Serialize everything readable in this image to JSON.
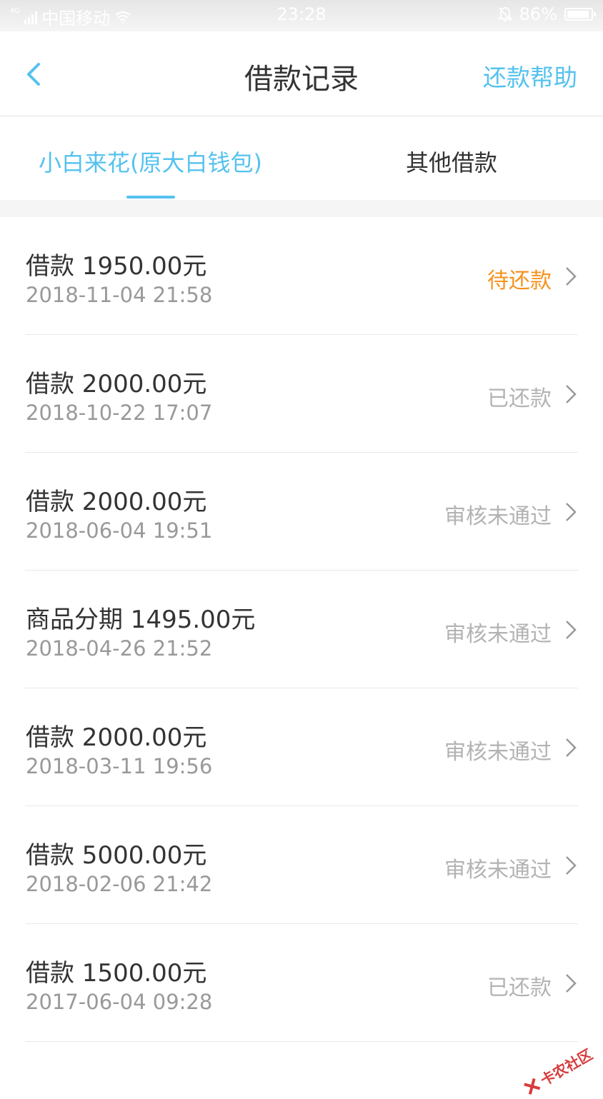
{
  "status_bar": {
    "network_type": "4G",
    "carrier": "中国移动",
    "time": "23:28",
    "battery": "86%",
    "icons": [
      "signal-icon",
      "wifi-icon",
      "bell-off-icon",
      "battery-icon"
    ]
  },
  "header": {
    "title": "借款记录",
    "help_label": "还款帮助",
    "back_icon": "chevron-left-icon"
  },
  "tabs": [
    {
      "label": "小白来花(原大白钱包)",
      "active": true
    },
    {
      "label": "其他借款",
      "active": false
    }
  ],
  "records": [
    {
      "title": "借款 1950.00元",
      "date": "2018-11-04 21:58",
      "status": "待还款",
      "status_type": "pending"
    },
    {
      "title": "借款 2000.00元",
      "date": "2018-10-22 17:07",
      "status": "已还款",
      "status_type": "repaid"
    },
    {
      "title": "借款 2000.00元",
      "date": "2018-06-04 19:51",
      "status": "审核未通过",
      "status_type": "rejected"
    },
    {
      "title": "商品分期 1495.00元",
      "date": "2018-04-26 21:52",
      "status": "审核未通过",
      "status_type": "rejected"
    },
    {
      "title": "借款 2000.00元",
      "date": "2018-03-11 19:56",
      "status": "审核未通过",
      "status_type": "rejected"
    },
    {
      "title": "借款 5000.00元",
      "date": "2018-02-06 21:42",
      "status": "审核未通过",
      "status_type": "rejected"
    },
    {
      "title": "借款 1500.00元",
      "date": "2017-06-04 09:28",
      "status": "已还款",
      "status_type": "repaid"
    }
  ],
  "watermark": "卡农社区",
  "colors": {
    "accent": "#55c2ee",
    "pending": "#f5921e",
    "muted": "#b3b3b3"
  }
}
